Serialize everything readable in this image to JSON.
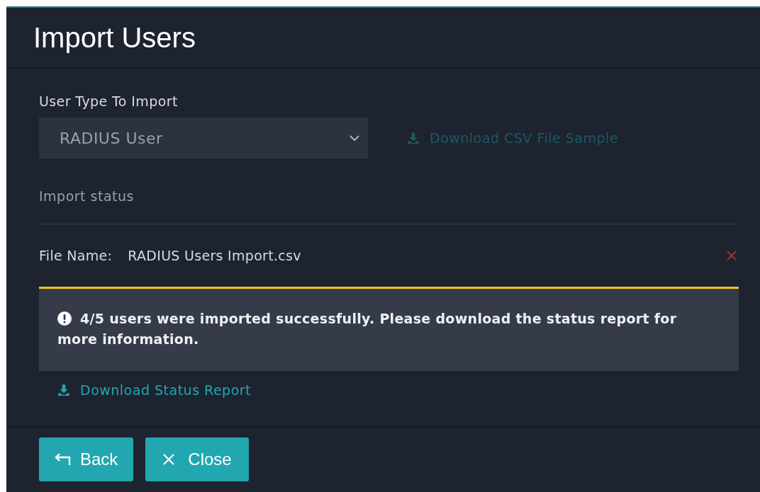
{
  "dialog": {
    "title": "Import Users"
  },
  "user_type": {
    "label": "User Type To Import",
    "value": "RADIUS User",
    "disabled": true
  },
  "sample_link": {
    "label": "Download CSV File Sample",
    "disabled": true
  },
  "import_status": {
    "label": "Import status",
    "disabled": true
  },
  "file": {
    "label": "File Name:",
    "value": "RADIUS Users Import.csv"
  },
  "alert": {
    "message": "4/5 users were imported successfully. Please download the status report for more information."
  },
  "report_link": {
    "label": "Download Status Report",
    "disabled": false
  },
  "buttons": [
    {
      "kind": "back",
      "label": "Back"
    },
    {
      "kind": "close",
      "label": "Close"
    }
  ]
}
